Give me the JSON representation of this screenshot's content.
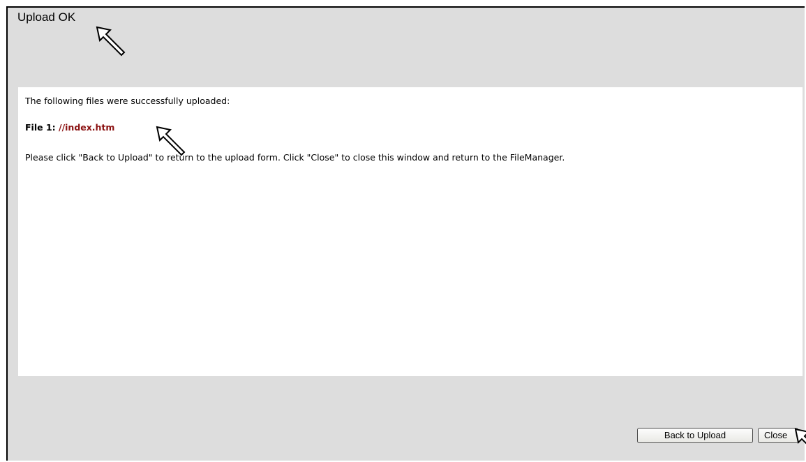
{
  "window": {
    "title": "Upload OK"
  },
  "content": {
    "intro": "The following files were successfully uploaded:",
    "file_label": "File 1:",
    "file_name": "//index.htm",
    "instructions": "Please click \"Back to Upload\" to return to the upload form. Click \"Close\" to close this window and return to the FileManager."
  },
  "buttons": {
    "back": "Back to Upload",
    "close": "Close"
  },
  "icons": {
    "pointer_arrows": "arrow-pointer-icon"
  },
  "colors": {
    "window_bg": "#dddddd",
    "content_bg": "#ffffff",
    "file_name": "#8b1111"
  }
}
